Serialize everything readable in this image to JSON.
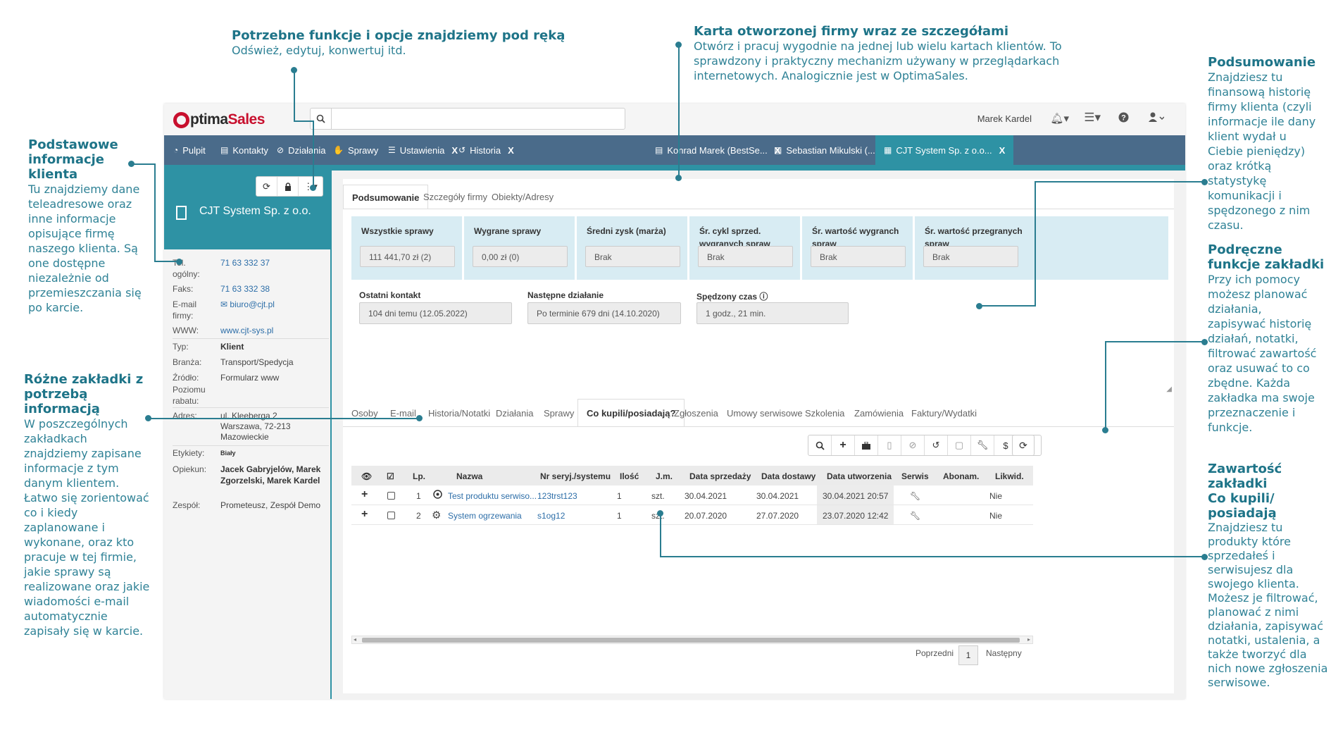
{
  "annotations": {
    "functions": {
      "title": "Potrzebne funkcje i opcje znajdziemy pod ręką",
      "body": "Odśwież, edytuj, konwertuj itd."
    },
    "card": {
      "title": "Karta otworzonej firmy wraz ze szczegółami",
      "body_lines": [
        "Otwórz i pracuj wygodnie na jednej lub wielu kartach klientów. To",
        "sprawdzony i praktyczny mechanizm używany w przeglądarkach",
        "internetowych. Analogicznie jest w OptimaSales."
      ]
    },
    "basic": {
      "title_lines": [
        "Podstawowe",
        "informacje",
        "klienta"
      ],
      "body_lines": [
        "Tu znajdziemy dane",
        "teleadresowe oraz",
        "inne informacje",
        "opisujące firmę",
        "naszego klienta. Są",
        "one dostępne",
        "niezależnie od",
        "przemieszczania się",
        "po karcie."
      ]
    },
    "tabs": {
      "title_lines": [
        "Różne zakładki z",
        "potrzebą informacją"
      ],
      "body_lines": [
        "W poszczególnych",
        "zakładkach",
        "znajdziemy zapisane",
        "informacje z tym",
        "danym klientem.",
        "Łatwo się zorientować",
        "co i kiedy",
        "zaplanowane i",
        "wykonane, oraz kto",
        "pracuje w tej firmie,",
        "jakie sprawy są",
        "realizowane oraz jakie",
        "wiadomości e-mail",
        "automatycznie",
        "zapisały się w karcie."
      ]
    },
    "summary": {
      "title": "Podsumowanie",
      "body_lines": [
        "Znajdziesz tu",
        "finansową historię",
        "firmy klienta (czyli",
        "informacje ile dany",
        "klient wydał u",
        "Ciebie pieniędzy)",
        "oraz krótką",
        "statystykę",
        "komunikacji i",
        "spędzonego z nim",
        "czasu."
      ]
    },
    "tabfunc": {
      "title_lines": [
        "Podręczne",
        "funkcje zakładki"
      ],
      "body_lines": [
        "Przy ich pomocy",
        "możesz planować",
        "działania,",
        "zapisywać historię",
        "działań, notatki,",
        "filtrować zawartość",
        "oraz usuwać to co",
        "zbędne. Każda",
        "zakładka ma swoje",
        "przeznaczenie i",
        "funkcje."
      ]
    },
    "content": {
      "title_lines": [
        "Zawartość zakładki",
        "Co kupili/",
        "posiadają"
      ],
      "body_lines": [
        "Znajdziesz tu",
        "produkty które",
        "sprzedałeś i",
        "serwisujesz dla",
        "swojego klienta.",
        "Możesz je filtrować,",
        "planować z nimi",
        "działania, zapisywać",
        "notatki, ustalenia, a",
        "także tworzyć dla",
        "nich nowe zgłoszenia",
        "serwisowe."
      ]
    }
  },
  "app": {
    "logo_o": "O",
    "logo_rest": "ptima",
    "logo_red": "Sales",
    "search": {
      "placeholder": "",
      "value": ""
    },
    "user": "Marek Kardel",
    "icons": [
      "bell-icon",
      "menu-icon",
      "help-icon",
      "user-icon"
    ],
    "accent": "#2e92a4",
    "nav_color": "#4a6b8a"
  },
  "main_tabs": [
    {
      "label": "Pulpit",
      "icon": "dashboard-icon",
      "closable": false
    },
    {
      "label": "Kontakty",
      "icon": "contacts-icon",
      "closable": false
    },
    {
      "label": "Działania",
      "icon": "check-circle-icon",
      "closable": false
    },
    {
      "label": "Sprawy",
      "icon": "handshake-icon",
      "closable": false
    },
    {
      "label": "Ustawienia",
      "icon": "sliders-icon",
      "closable": true
    },
    {
      "label": "Historia",
      "icon": "history-icon",
      "closable": true
    },
    {
      "label": "Konrad Marek (BestSe...",
      "icon": "card-icon",
      "closable": true
    },
    {
      "label": "Sebastian Mikulski (...",
      "icon": "card-icon",
      "closable": true
    },
    {
      "label": "CJT System Sp. z o.o...",
      "icon": "building-icon",
      "closable": true,
      "active": true
    }
  ],
  "close_glyph": "X",
  "company": {
    "name": "CJT System Sp. z o.o.",
    "fields": {
      "tel_label": "Tel. ogólny:",
      "tel": "71 63 332 37",
      "fax_label": "Faks:",
      "fax": "71 63 332 38",
      "email_label": "E-mail firmy:",
      "email": "biuro@cjt.pl",
      "www_label": "WWW:",
      "www": "www.cjt-sys.pl",
      "type_label": "Typ:",
      "type": "Klient",
      "branch_label": "Branża:",
      "branch": "Transport/Spedycja",
      "source_label": "Źródło:",
      "source": "Formularz www",
      "discount_label": "Poziomu rabatu:",
      "discount": "",
      "address_label": "Adres:",
      "address_1": "ul. Kleeberga 2",
      "address_2": "Warszawa, 72-213",
      "address_3": "Mazowieckie",
      "tags_label": "Etykiety:",
      "tags": "Biały",
      "guardian_label": "Opiekun:",
      "guardian": "Jacek Gabryjelów, Marek Zgorzelski, Marek Kardel",
      "team_label": "Zespół:",
      "team": "Prometeusz, Zespół Demo"
    }
  },
  "sub_tabs": [
    "Podsumowanie",
    "Szczegóły firmy",
    "Obiekty/Adresy"
  ],
  "summary": {
    "cols": [
      {
        "label": "Wszystkie sprawy",
        "value": "111 441,70 zł (2)"
      },
      {
        "label": "Wygrane sprawy",
        "value": "0,00 zł (0)"
      },
      {
        "label": "Średni zysk (marża)",
        "value": "Brak"
      },
      {
        "label": "Śr. cykl sprzed. wygranych spraw",
        "value": "Brak"
      },
      {
        "label": "Śr. wartość wygranch spraw",
        "value": "Brak"
      },
      {
        "label": "Śr. wartość przegranych spraw",
        "value": "Brak"
      }
    ],
    "last_contact_label": "Ostatni kontakt",
    "last_contact": "104 dni temu (12.05.2022)",
    "next_action_label": "Następne działanie",
    "next_action": "Po terminie 679 dni (14.10.2020)",
    "time_spent_label": "Spędzony czas",
    "time_spent": "1 godz., 21 min."
  },
  "bottom_tabs": [
    "Osoby",
    "E-mail",
    "Historia/Notatki",
    "Działania",
    "Sprawy",
    "Co kupili/posiadają?",
    "Zgłoszenia",
    "Umowy serwisowe",
    "Szkolenia",
    "Zamówienia",
    "Faktury/Wydatki"
  ],
  "toolbar_icons": [
    "search-icon",
    "plus-icon",
    "briefcase-icon",
    "document-icon",
    "check-circle-icon",
    "history-icon",
    "note-icon",
    "wrench-icon",
    "dollar-icon",
    "trash-icon"
  ],
  "products": {
    "headers": [
      "Lp.",
      "Nazwa",
      "Nr seryj./systemu",
      "Ilość",
      "J.m.",
      "Data sprzedaży",
      "Data dostawy",
      "Data utworzenia",
      "Serwis",
      "Abonam.",
      "Likwid."
    ],
    "rows": [
      {
        "lp": "1",
        "name": "Test produktu serwiso...",
        "serial": "123trst123",
        "qty": "1",
        "unit": "szt.",
        "sale": "30.04.2021",
        "delivery": "30.04.2021",
        "created": "30.04.2021 20:57",
        "liquid": "Nie"
      },
      {
        "lp": "2",
        "name": "System ogrzewania",
        "serial": "s1og12",
        "qty": "1",
        "unit": "szt.",
        "sale": "20.07.2020",
        "delivery": "27.07.2020",
        "created": "23.07.2020 12:42",
        "liquid": "Nie"
      }
    ]
  },
  "pager": {
    "prev": "Poprzedni",
    "page": "1",
    "next": "Następny"
  }
}
